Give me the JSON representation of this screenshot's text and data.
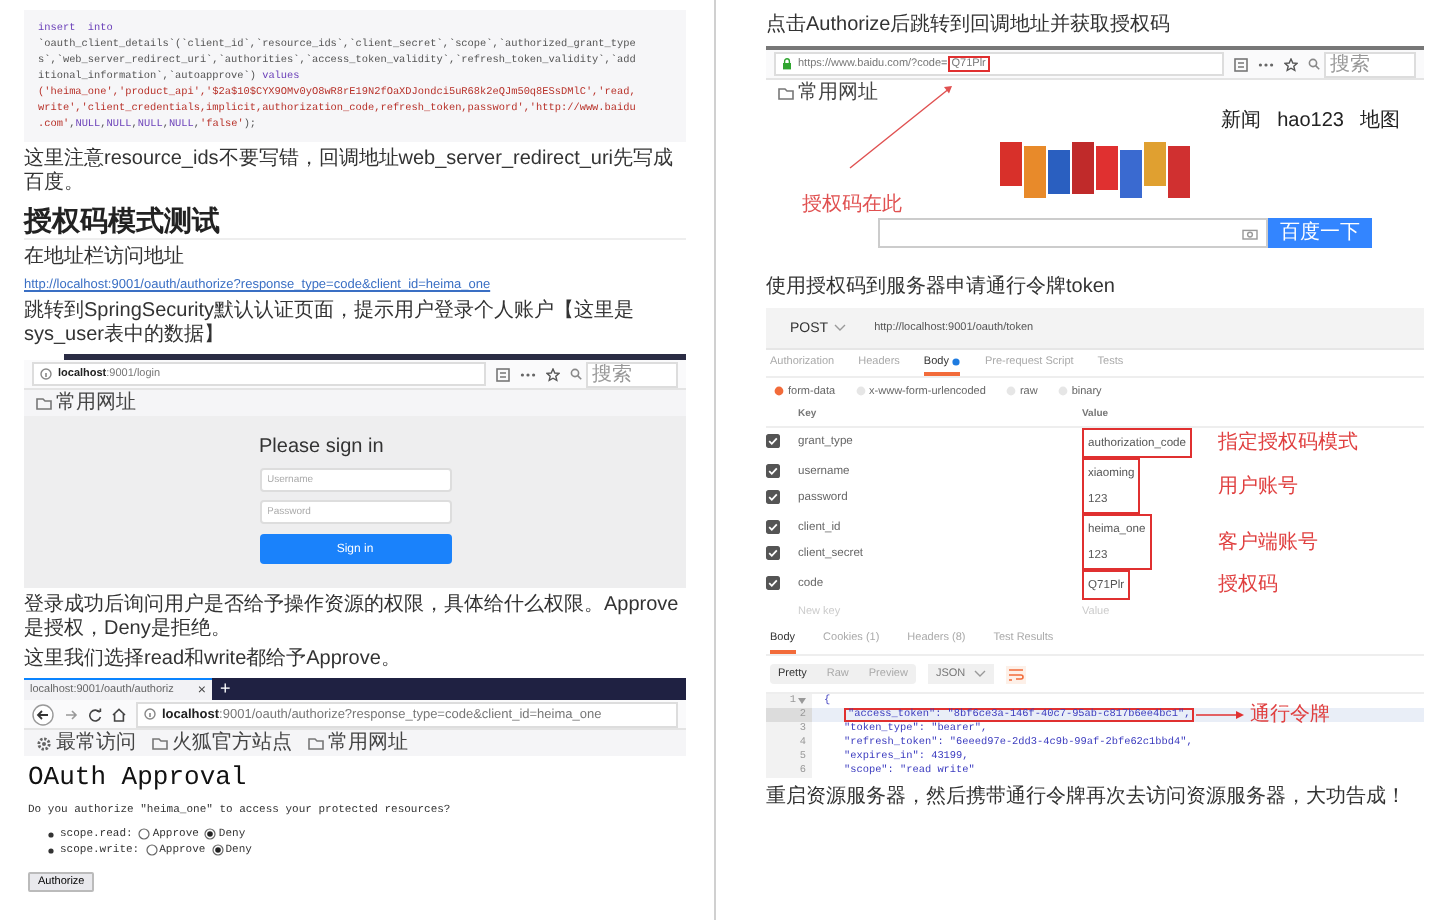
{
  "left_page": {
    "code_block": {
      "lines": [
        [
          {
            "text": "insert  into",
            "kind": "keyword"
          }
        ],
        [
          {
            "text": "`oauth_client_details`(`client_id`,`resource_ids`,`client_secret`,`scope`,`authorized_grant_type",
            "kind": "plain"
          }
        ],
        [
          {
            "text": "s`,`web_server_redirect_uri`,`authorities`,`access_token_validity`,`refresh_token_validity`,`add",
            "kind": "plain"
          }
        ],
        [
          {
            "text": "itional_information`,`autoapprove`) ",
            "kind": "plain"
          },
          {
            "text": "values",
            "kind": "keyword"
          }
        ],
        [
          {
            "text": "('heima_one','product_api','$2a$10$CYX9OMv0yO8wR8rE19N2fOaXDJondci5uR68k2eQJm50q8ESsDMlC','read,",
            "kind": "string"
          }
        ],
        [
          {
            "text": "write','client_credentials,implicit,authorization_code,refresh_token,password','http://www.baidu",
            "kind": "string"
          }
        ],
        [
          {
            "text": ".com'",
            "kind": "string"
          },
          {
            "text": ",",
            "kind": "plain"
          },
          {
            "text": "NULL",
            "kind": "keyword"
          },
          {
            "text": ",",
            "kind": "plain"
          },
          {
            "text": "NULL",
            "kind": "keyword"
          },
          {
            "text": ",",
            "kind": "plain"
          },
          {
            "text": "NULL",
            "kind": "keyword"
          },
          {
            "text": ",",
            "kind": "plain"
          },
          {
            "text": "NULL",
            "kind": "keyword"
          },
          {
            "text": ",",
            "kind": "plain"
          },
          {
            "text": "'false'",
            "kind": "string"
          },
          {
            "text": ");",
            "kind": "plain"
          }
        ]
      ]
    },
    "note": "这里注意resource_ids不要写错，回调地址web_server_redirect_uri先写成百度。",
    "heading": "授权码模式测试",
    "step_text": "在地址栏访问地址",
    "link": "http://localhost:9001/oauth/authorize?response_type=code&client_id=heima_one",
    "login_intro": "跳转到SpringSecurity默认认证页面，提示用户登录个人账户【这里是sys_user表中的数据】",
    "login_screenshot": {
      "url": "**localhost**:9001/login",
      "search_placeholder": "搜索",
      "bookmarks": [
        {
          "label": "常用网址",
          "kind": "folder"
        }
      ],
      "title": "Please sign in",
      "username_placeholder": "Username",
      "password_placeholder": "Password",
      "button": "Sign in"
    },
    "approve_text_1": "登录成功后询问用户是否给予操作资源的权限，具体给什么权限。Approve是授权，Deny是拒绝。",
    "approve_text_2": "这里我们选择read和write都给予Approve。",
    "approval_screenshot": {
      "tab_title": "localhost:9001/oauth/authoriz",
      "tab_close": "×",
      "new_tab": "+",
      "url": "**localhost**:9001/oauth/authorize?response_type=code&client_id=heima_one",
      "bookmarks": [
        {
          "label": "最常访问",
          "kind": "gear"
        },
        {
          "label": "火狐官方站点",
          "kind": "folder"
        },
        {
          "label": "常用网址",
          "kind": "folder"
        }
      ],
      "title": "OAuth Approval",
      "question": "Do you authorize \"heima_one\" to access your protected resources?",
      "scopes": [
        {
          "label": "scope.read:",
          "options": [
            {
              "label": "Approve",
              "selected": false
            },
            {
              "label": "Deny",
              "selected": true
            }
          ]
        },
        {
          "label": "scope.write:",
          "options": [
            {
              "label": "Approve",
              "selected": false
            },
            {
              "label": "Deny",
              "selected": true
            }
          ]
        }
      ],
      "button": "Authorize"
    }
  },
  "right_page": {
    "intro": "点击Authorize后跳转到回调地址并获取授权码",
    "baidu_screenshot": {
      "url_prefix": "https://www.baidu.com/?code=",
      "code": "Q71Plr",
      "search_placeholder": "搜索",
      "bookmarks": [
        {
          "label": "常用网址",
          "kind": "folder"
        }
      ],
      "top_links": [
        "新闻",
        "hao123",
        "地图"
      ],
      "search_button": "百度一下",
      "annotation": "授权码在此"
    },
    "token_intro": "使用授权码到服务器申请通行令牌token",
    "postman": {
      "method": "POST",
      "url": "http://localhost:9001/oauth/token",
      "request_tabs": [
        {
          "label": "Authorization",
          "selected": false,
          "indicator": false
        },
        {
          "label": "Headers",
          "selected": false,
          "indicator": false
        },
        {
          "label": "Body",
          "selected": true,
          "indicator": true
        },
        {
          "label": "Pre-request Script",
          "selected": false,
          "indicator": false
        },
        {
          "label": "Tests",
          "selected": false,
          "indicator": false
        }
      ],
      "body_types": [
        {
          "label": "form-data",
          "selected": true
        },
        {
          "label": "x-www-form-urlencoded",
          "selected": false
        },
        {
          "label": "raw",
          "selected": false
        },
        {
          "label": "binary",
          "selected": false
        }
      ],
      "columns": [
        "Key",
        "Value"
      ],
      "param_groups": [
        {
          "note": "指定授权码模式",
          "highlighted": true,
          "params": [
            {
              "key": "grant_type",
              "value": "authorization_code",
              "checked": true
            }
          ]
        },
        {
          "note": "用户账号",
          "highlighted": true,
          "params": [
            {
              "key": "username",
              "value": "xiaoming",
              "checked": true
            },
            {
              "key": "password",
              "value": "123",
              "checked": true
            }
          ]
        },
        {
          "note": "客户端账号",
          "highlighted": true,
          "params": [
            {
              "key": "client_id",
              "value": "heima_one",
              "checked": true
            },
            {
              "key": "client_secret",
              "value": "123",
              "checked": true
            }
          ]
        },
        {
          "note": "授权码",
          "highlighted": true,
          "params": [
            {
              "key": "code",
              "value": "Q71Plr",
              "checked": true
            }
          ]
        }
      ],
      "new_row": {
        "key_placeholder": "New key",
        "value_placeholder": "Value"
      },
      "response_tabs": [
        {
          "label": "Body",
          "selected": true
        },
        {
          "label": "Cookies (1)",
          "selected": false
        },
        {
          "label": "Headers (8)",
          "selected": false
        },
        {
          "label": "Test Results",
          "selected": false
        }
      ],
      "view_modes": [
        {
          "label": "Pretty",
          "selected": true
        },
        {
          "label": "Raw",
          "selected": false
        },
        {
          "label": "Preview",
          "selected": false
        }
      ],
      "format": "JSON",
      "json_lines": [
        {
          "number": "1",
          "text": "{",
          "kind": "brace",
          "foldable": true,
          "highlighted": false
        },
        {
          "number": "2",
          "text": "\"access_token\": \"8bf6ce3a-146f-40c7-95ab-c817b6ee4bc1\",",
          "kind": "member",
          "foldable": false,
          "highlighted": true,
          "annotation": "通行令牌"
        },
        {
          "number": "3",
          "text": "\"token_type\": \"bearer\",",
          "kind": "member",
          "foldable": false,
          "highlighted": false
        },
        {
          "number": "4",
          "text": "\"refresh_token\": \"6eeed97e-2dd3-4c9b-99af-2bfe62c1bbd4\",",
          "kind": "member",
          "foldable": false,
          "highlighted": false
        },
        {
          "number": "5",
          "text": "\"expires_in\": 43199,",
          "kind": "member",
          "foldable": false,
          "highlighted": false
        },
        {
          "number": "6",
          "text": "\"scope\": \"read write\"",
          "kind": "member",
          "foldable": false,
          "highlighted": false
        }
      ]
    },
    "outro": "重启资源服务器，然后携带通行令牌再次去访问资源服务器，大功告成！"
  }
}
